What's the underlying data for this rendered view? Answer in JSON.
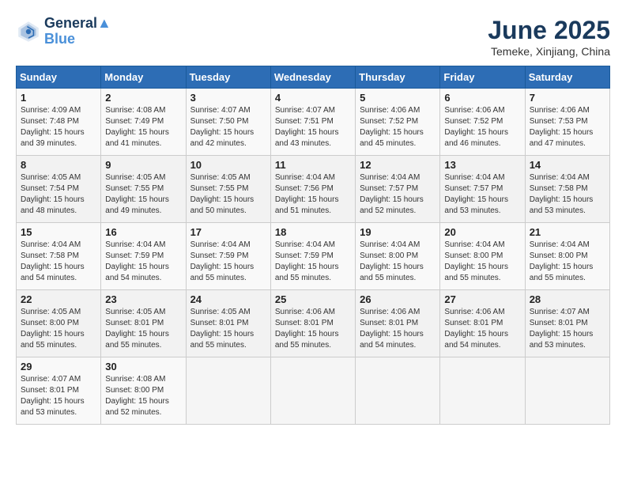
{
  "header": {
    "logo_line1": "General",
    "logo_line2": "Blue",
    "month": "June 2025",
    "location": "Temeke, Xinjiang, China"
  },
  "weekdays": [
    "Sunday",
    "Monday",
    "Tuesday",
    "Wednesday",
    "Thursday",
    "Friday",
    "Saturday"
  ],
  "weeks": [
    [
      {
        "day": "1",
        "info": "Sunrise: 4:09 AM\nSunset: 7:48 PM\nDaylight: 15 hours\nand 39 minutes."
      },
      {
        "day": "2",
        "info": "Sunrise: 4:08 AM\nSunset: 7:49 PM\nDaylight: 15 hours\nand 41 minutes."
      },
      {
        "day": "3",
        "info": "Sunrise: 4:07 AM\nSunset: 7:50 PM\nDaylight: 15 hours\nand 42 minutes."
      },
      {
        "day": "4",
        "info": "Sunrise: 4:07 AM\nSunset: 7:51 PM\nDaylight: 15 hours\nand 43 minutes."
      },
      {
        "day": "5",
        "info": "Sunrise: 4:06 AM\nSunset: 7:52 PM\nDaylight: 15 hours\nand 45 minutes."
      },
      {
        "day": "6",
        "info": "Sunrise: 4:06 AM\nSunset: 7:52 PM\nDaylight: 15 hours\nand 46 minutes."
      },
      {
        "day": "7",
        "info": "Sunrise: 4:06 AM\nSunset: 7:53 PM\nDaylight: 15 hours\nand 47 minutes."
      }
    ],
    [
      {
        "day": "8",
        "info": "Sunrise: 4:05 AM\nSunset: 7:54 PM\nDaylight: 15 hours\nand 48 minutes."
      },
      {
        "day": "9",
        "info": "Sunrise: 4:05 AM\nSunset: 7:55 PM\nDaylight: 15 hours\nand 49 minutes."
      },
      {
        "day": "10",
        "info": "Sunrise: 4:05 AM\nSunset: 7:55 PM\nDaylight: 15 hours\nand 50 minutes."
      },
      {
        "day": "11",
        "info": "Sunrise: 4:04 AM\nSunset: 7:56 PM\nDaylight: 15 hours\nand 51 minutes."
      },
      {
        "day": "12",
        "info": "Sunrise: 4:04 AM\nSunset: 7:57 PM\nDaylight: 15 hours\nand 52 minutes."
      },
      {
        "day": "13",
        "info": "Sunrise: 4:04 AM\nSunset: 7:57 PM\nDaylight: 15 hours\nand 53 minutes."
      },
      {
        "day": "14",
        "info": "Sunrise: 4:04 AM\nSunset: 7:58 PM\nDaylight: 15 hours\nand 53 minutes."
      }
    ],
    [
      {
        "day": "15",
        "info": "Sunrise: 4:04 AM\nSunset: 7:58 PM\nDaylight: 15 hours\nand 54 minutes."
      },
      {
        "day": "16",
        "info": "Sunrise: 4:04 AM\nSunset: 7:59 PM\nDaylight: 15 hours\nand 54 minutes."
      },
      {
        "day": "17",
        "info": "Sunrise: 4:04 AM\nSunset: 7:59 PM\nDaylight: 15 hours\nand 55 minutes."
      },
      {
        "day": "18",
        "info": "Sunrise: 4:04 AM\nSunset: 7:59 PM\nDaylight: 15 hours\nand 55 minutes."
      },
      {
        "day": "19",
        "info": "Sunrise: 4:04 AM\nSunset: 8:00 PM\nDaylight: 15 hours\nand 55 minutes."
      },
      {
        "day": "20",
        "info": "Sunrise: 4:04 AM\nSunset: 8:00 PM\nDaylight: 15 hours\nand 55 minutes."
      },
      {
        "day": "21",
        "info": "Sunrise: 4:04 AM\nSunset: 8:00 PM\nDaylight: 15 hours\nand 55 minutes."
      }
    ],
    [
      {
        "day": "22",
        "info": "Sunrise: 4:05 AM\nSunset: 8:00 PM\nDaylight: 15 hours\nand 55 minutes."
      },
      {
        "day": "23",
        "info": "Sunrise: 4:05 AM\nSunset: 8:01 PM\nDaylight: 15 hours\nand 55 minutes."
      },
      {
        "day": "24",
        "info": "Sunrise: 4:05 AM\nSunset: 8:01 PM\nDaylight: 15 hours\nand 55 minutes."
      },
      {
        "day": "25",
        "info": "Sunrise: 4:06 AM\nSunset: 8:01 PM\nDaylight: 15 hours\nand 55 minutes."
      },
      {
        "day": "26",
        "info": "Sunrise: 4:06 AM\nSunset: 8:01 PM\nDaylight: 15 hours\nand 54 minutes."
      },
      {
        "day": "27",
        "info": "Sunrise: 4:06 AM\nSunset: 8:01 PM\nDaylight: 15 hours\nand 54 minutes."
      },
      {
        "day": "28",
        "info": "Sunrise: 4:07 AM\nSunset: 8:01 PM\nDaylight: 15 hours\nand 53 minutes."
      }
    ],
    [
      {
        "day": "29",
        "info": "Sunrise: 4:07 AM\nSunset: 8:01 PM\nDaylight: 15 hours\nand 53 minutes."
      },
      {
        "day": "30",
        "info": "Sunrise: 4:08 AM\nSunset: 8:00 PM\nDaylight: 15 hours\nand 52 minutes."
      },
      null,
      null,
      null,
      null,
      null
    ]
  ]
}
